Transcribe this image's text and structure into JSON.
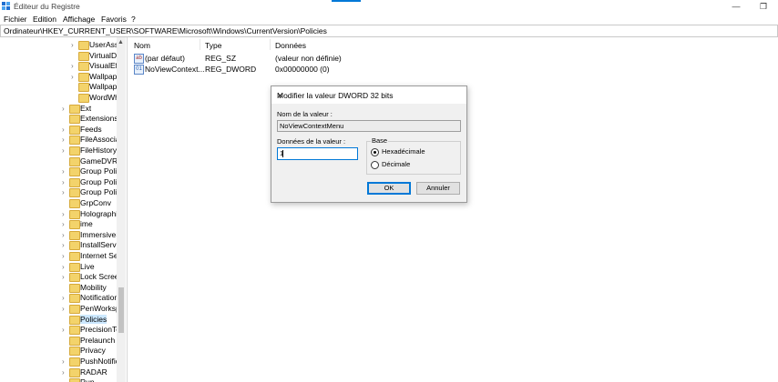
{
  "window": {
    "title": "Éditeur du Registre",
    "minimize": "—",
    "restore": "❐"
  },
  "menu": [
    "Fichier",
    "Edition",
    "Affichage",
    "Favoris",
    "?"
  ],
  "address": "Ordinateur\\HKEY_CURRENT_USER\\SOFTWARE\\Microsoft\\Windows\\CurrentVersion\\Policies",
  "tree": [
    {
      "label": "UserAssi",
      "indent": 2,
      "expandable": true
    },
    {
      "label": "VirtualD",
      "indent": 2,
      "expandable": false
    },
    {
      "label": "VisualEf",
      "indent": 2,
      "expandable": true
    },
    {
      "label": "Wallpap",
      "indent": 2,
      "expandable": true
    },
    {
      "label": "Wallpap",
      "indent": 2,
      "expandable": false
    },
    {
      "label": "WordWh",
      "indent": 2,
      "expandable": false
    },
    {
      "label": "Ext",
      "indent": 1,
      "expandable": true
    },
    {
      "label": "Extensions",
      "indent": 1,
      "expandable": false
    },
    {
      "label": "Feeds",
      "indent": 1,
      "expandable": true
    },
    {
      "label": "FileAssocia",
      "indent": 1,
      "expandable": true
    },
    {
      "label": "FileHistory",
      "indent": 1,
      "expandable": true
    },
    {
      "label": "GameDVR",
      "indent": 1,
      "expandable": false
    },
    {
      "label": "Group Polic",
      "indent": 1,
      "expandable": true
    },
    {
      "label": "Group Polic",
      "indent": 1,
      "expandable": true
    },
    {
      "label": "Group Polic",
      "indent": 1,
      "expandable": true
    },
    {
      "label": "GrpConv",
      "indent": 1,
      "expandable": false
    },
    {
      "label": "Holographi",
      "indent": 1,
      "expandable": true
    },
    {
      "label": "ime",
      "indent": 1,
      "expandable": true
    },
    {
      "label": "ImmersiveS",
      "indent": 1,
      "expandable": true
    },
    {
      "label": "InstallServic",
      "indent": 1,
      "expandable": true
    },
    {
      "label": "Internet Set",
      "indent": 1,
      "expandable": true
    },
    {
      "label": "Live",
      "indent": 1,
      "expandable": true
    },
    {
      "label": "Lock Screer",
      "indent": 1,
      "expandable": true
    },
    {
      "label": "Mobility",
      "indent": 1,
      "expandable": false
    },
    {
      "label": "Notification",
      "indent": 1,
      "expandable": true
    },
    {
      "label": "PenWorksp",
      "indent": 1,
      "expandable": true
    },
    {
      "label": "Policies",
      "indent": 1,
      "expandable": false,
      "selected": true
    },
    {
      "label": "PrecisionTo",
      "indent": 1,
      "expandable": true
    },
    {
      "label": "Prelaunch",
      "indent": 1,
      "expandable": false
    },
    {
      "label": "Privacy",
      "indent": 1,
      "expandable": false
    },
    {
      "label": "PushNotific",
      "indent": 1,
      "expandable": true
    },
    {
      "label": "RADAR",
      "indent": 1,
      "expandable": true
    },
    {
      "label": "Run",
      "indent": 1,
      "expandable": false
    }
  ],
  "list": {
    "columns": [
      "Nom",
      "Type",
      "Données"
    ],
    "rows": [
      {
        "name": "(par défaut)",
        "type": "REG_SZ",
        "data": "(valeur non définie)",
        "icon": "ab"
      },
      {
        "name": "NoViewContext...",
        "type": "REG_DWORD",
        "data": "0x00000000 (0)",
        "icon": "01"
      }
    ]
  },
  "dialog": {
    "title": "Modifier la valeur DWORD 32 bits",
    "close": "✕",
    "name_label": "Nom de la valeur :",
    "name_value": "NoViewContextMenu",
    "data_label": "Données de la valeur :",
    "data_value": "1",
    "base_label": "Base",
    "radio_hex": "Hexadécimale",
    "radio_dec": "Décimale",
    "ok": "OK",
    "cancel": "Annuler"
  },
  "colors": {
    "accent": "#0078d7",
    "folder": "#f3d36b",
    "selection": "#cce8ff"
  }
}
